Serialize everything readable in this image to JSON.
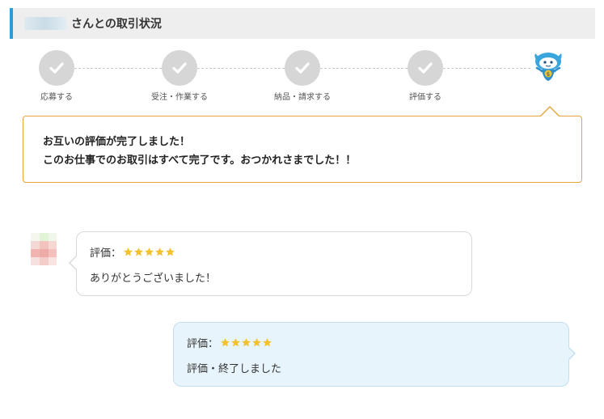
{
  "header": {
    "title": "さんとの取引状況"
  },
  "steps": [
    {
      "label": "応募する",
      "status": "complete"
    },
    {
      "label": "受注・作業する",
      "status": "complete"
    },
    {
      "label": "納品・請求する",
      "status": "complete"
    },
    {
      "label": "評価する",
      "status": "complete"
    },
    {
      "label": "",
      "status": "current",
      "icon": "mascot-icon"
    }
  ],
  "notice": {
    "line1": "お互いの評価が完了しました！",
    "line2": "このお仕事でのお取引はすべて完了です。おつかれさまでした！！"
  },
  "messages": [
    {
      "side": "left",
      "rating_label": "評価：",
      "rating_stars": 5,
      "text": "ありがとうございました！"
    },
    {
      "side": "right",
      "rating_label": "評価：",
      "rating_stars": 5,
      "text": "評価・終了しました"
    }
  ],
  "colors": {
    "accent": "#2f9bd3",
    "notice_border": "#e8a33c",
    "step_done": "#d6d6d6",
    "star": "#f2c12e",
    "right_bubble_bg": "#e8f4fb"
  }
}
